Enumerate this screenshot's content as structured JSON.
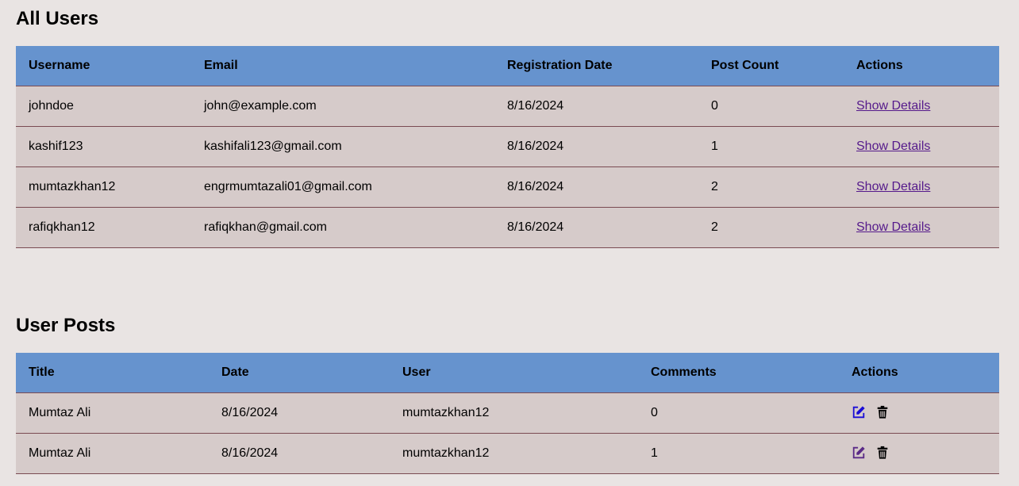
{
  "users_section": {
    "title": "All Users",
    "columns": [
      "Username",
      "Email",
      "Registration Date",
      "Post Count",
      "Actions"
    ],
    "rows": [
      {
        "username": "johndoe",
        "email": "john@example.com",
        "date": "8/16/2024",
        "post_count": "0",
        "action": "Show Details"
      },
      {
        "username": "kashif123",
        "email": "kashifali123@gmail.com",
        "date": "8/16/2024",
        "post_count": "1",
        "action": "Show Details"
      },
      {
        "username": "mumtazkhan12",
        "email": "engrmumtazali01@gmail.com",
        "date": "8/16/2024",
        "post_count": "2",
        "action": "Show Details"
      },
      {
        "username": "rafiqkhan12",
        "email": "rafiqkhan@gmail.com",
        "date": "8/16/2024",
        "post_count": "2",
        "action": "Show Details"
      }
    ]
  },
  "posts_section": {
    "title": "User Posts",
    "columns": [
      "Title",
      "Date",
      "User",
      "Comments",
      "Actions"
    ],
    "rows": [
      {
        "title": "Mumtaz Ali",
        "date": "8/16/2024",
        "user": "mumtazkhan12",
        "comments": "0",
        "edit_icon_color": "#1a0dd6",
        "delete_icon": "trash-icon"
      },
      {
        "title": "Mumtaz Ali",
        "date": "8/16/2024",
        "user": "mumtazkhan12",
        "comments": "1",
        "edit_icon_color": "#5a2a87",
        "delete_icon": "trash-icon"
      }
    ]
  },
  "colors": {
    "header_bg": "#6693ce",
    "row_bg": "#d6cbca",
    "page_bg": "#e9e4e3",
    "row_border": "#7a4b52",
    "link": "#551a8b"
  }
}
